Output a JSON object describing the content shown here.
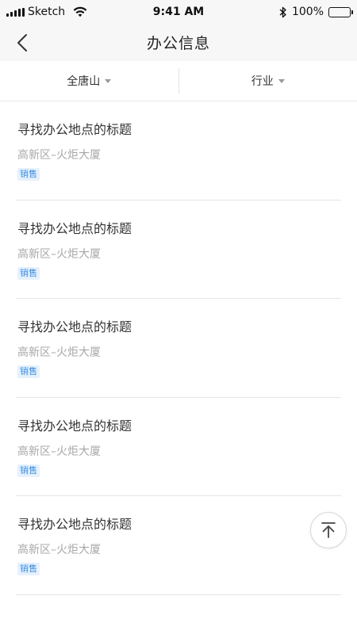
{
  "status_bar": {
    "carrier": "Sketch",
    "time": "9:41 AM",
    "battery_text": "100%",
    "icons": [
      "signal-icon",
      "wifi-icon",
      "bluetooth-icon",
      "battery-icon"
    ]
  },
  "nav": {
    "title": "办公信息",
    "back_icon": "chevron-left-icon"
  },
  "filters": [
    {
      "label": "全唐山"
    },
    {
      "label": "行业"
    }
  ],
  "list": {
    "items": [
      {
        "title": "寻找办公地点的标题",
        "location": "高新区–火炬大厦",
        "tag": "销售"
      },
      {
        "title": "寻找办公地点的标题",
        "location": "高新区–火炬大厦",
        "tag": "销售"
      },
      {
        "title": "寻找办公地点的标题",
        "location": "高新区–火炬大厦",
        "tag": "销售"
      },
      {
        "title": "寻找办公地点的标题",
        "location": "高新区–火炬大厦",
        "tag": "销售"
      },
      {
        "title": "寻找办公地点的标题",
        "location": "高新区–火炬大厦",
        "tag": "销售"
      }
    ]
  },
  "colors": {
    "bar_background": "#f7f7f7",
    "tag_text": "#3c8de3",
    "tag_background": "#e6f1fc"
  }
}
